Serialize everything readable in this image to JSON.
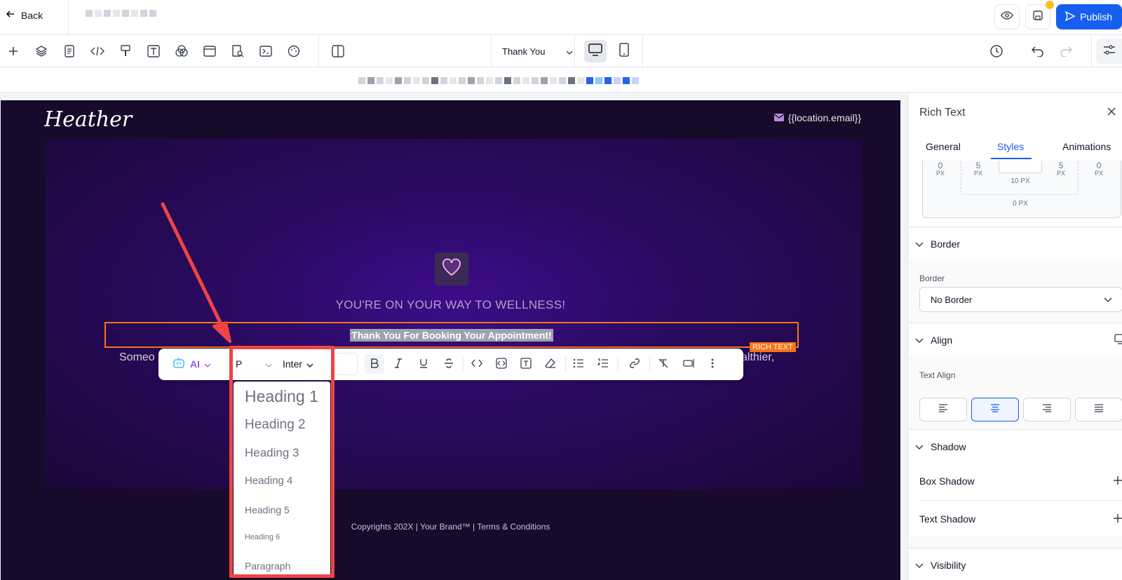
{
  "topbar": {
    "back_label": "Back",
    "publish_label": "Publish"
  },
  "toolbar": {
    "page_name": "Thank You"
  },
  "canvas": {
    "logo": "Heather",
    "email": "{{location.email}}",
    "tagline": "YOU'RE ON YOUR WAY TO WELLNESS!",
    "selected_text": "Thank You For Booking Your Appointment!",
    "element_label": "RICH TEXT",
    "body_left": "Someo",
    "body_right": "althier,",
    "footer": "Copyrights 202X | Your Brand™ | Terms & Conditions"
  },
  "format_toolbar": {
    "ai_label": "AI",
    "block_type": "P",
    "font": "Inter"
  },
  "block_dropdown": {
    "options": [
      "Heading 1",
      "Heading 2",
      "Heading 3",
      "Heading 4",
      "Heading 5",
      "Heading 6",
      "Paragraph"
    ]
  },
  "panel": {
    "title": "Rich Text",
    "tabs": [
      "General",
      "Styles",
      "Animations"
    ],
    "spacing": {
      "outer_left": "0",
      "inner_left": "5",
      "inner_right": "5",
      "outer_right": "0",
      "inner_bottom": "10 PX",
      "outer_bottom": "0 PX",
      "unit": "PX"
    },
    "border_section": "Border",
    "border_label": "Border",
    "border_value": "No Border",
    "align_section": "Align",
    "text_align_label": "Text Align",
    "shadow_section": "Shadow",
    "box_shadow": "Box Shadow",
    "text_shadow": "Text Shadow",
    "visibility_section": "Visibility"
  },
  "colors": {
    "accent": "#155eef",
    "highlight": "#ef4444",
    "selection": "#f97316"
  }
}
